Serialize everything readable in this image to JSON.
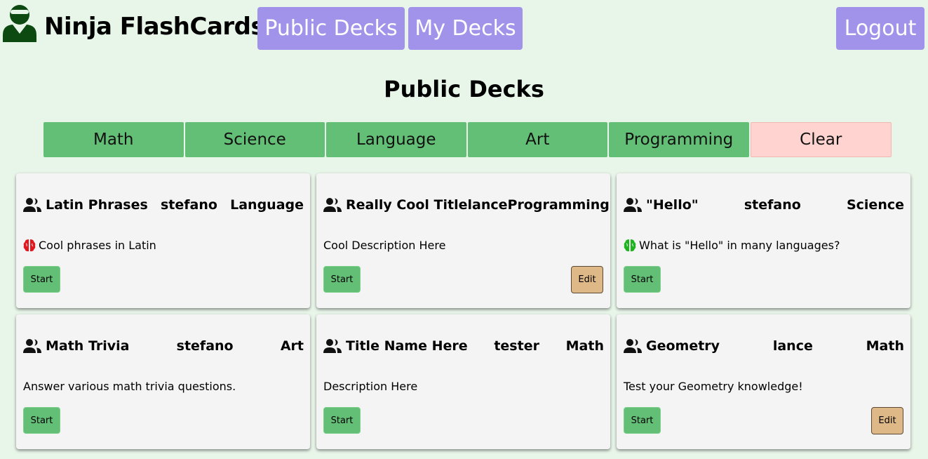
{
  "header": {
    "brand": "Ninja FlashCards",
    "nav": {
      "public_decks": "Public Decks",
      "my_decks": "My Decks",
      "logout": "Logout"
    }
  },
  "page": {
    "title": "Public Decks"
  },
  "filters": [
    "Math",
    "Science",
    "Language",
    "Art",
    "Programming"
  ],
  "filter_clear": "Clear",
  "start_label": "Start",
  "edit_label": "Edit",
  "cards": [
    {
      "title": "Latin Phrases",
      "author": "stefano",
      "category": "Language",
      "description": "Cool phrases in Latin",
      "brain_icon": "red",
      "editable": false
    },
    {
      "title": "Really Cool Title",
      "author": "lance",
      "category": "Programming",
      "description": "Cool Description Here",
      "brain_icon": "",
      "editable": true
    },
    {
      "title": "\"Hello\"",
      "author": "stefano",
      "category": "Science",
      "description": "What is \"Hello\" in many languages?",
      "brain_icon": "green",
      "editable": false
    },
    {
      "title": "Math Trivia",
      "author": "stefano",
      "category": "Art",
      "description": "Answer various math trivia questions.",
      "brain_icon": "",
      "editable": false
    },
    {
      "title": "Title Name Here",
      "author": "tester",
      "category": "Math",
      "description": "Description Here",
      "brain_icon": "",
      "editable": false
    },
    {
      "title": "Geometry",
      "author": "lance",
      "category": "Math",
      "description": "Test your Geometry knowledge!",
      "brain_icon": "",
      "editable": true
    }
  ],
  "colors": {
    "background": "#e8f5e9",
    "nav_button": "#a193ea",
    "filter_button": "#63bf76",
    "clear_button": "#ffd4d0",
    "start_button": "#63bf76",
    "edit_button": "#deb887",
    "brain_red": "#e0171f",
    "brain_green": "#1fb31f",
    "ninja": "#0d4a12"
  }
}
